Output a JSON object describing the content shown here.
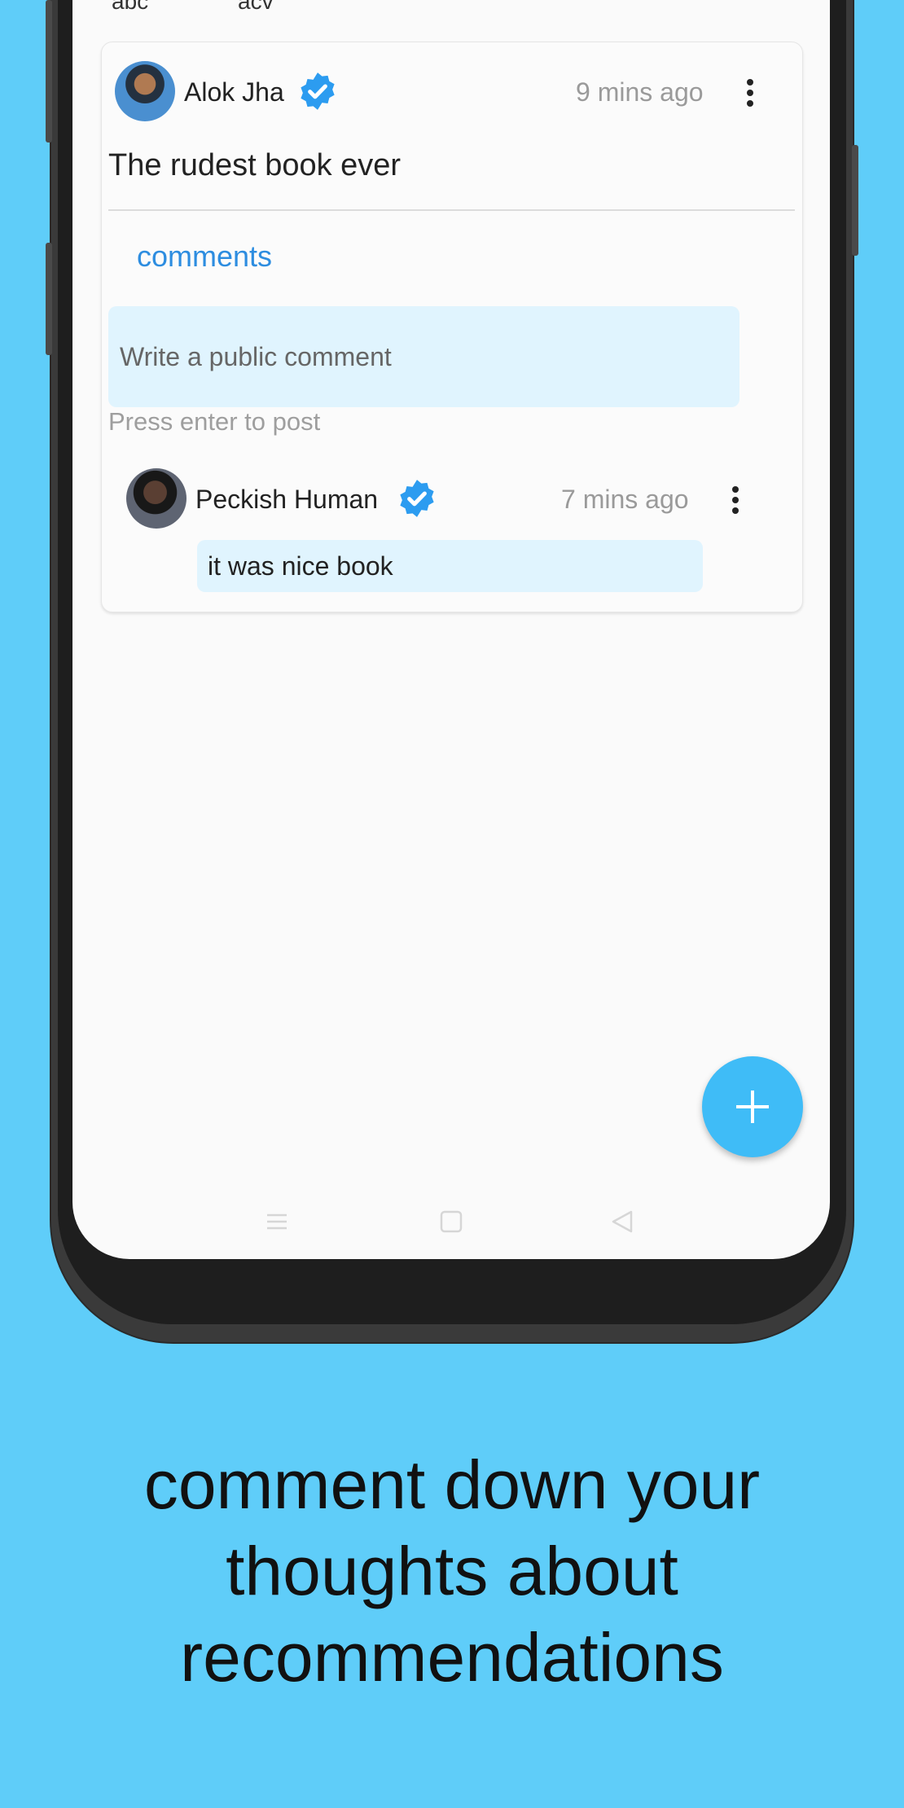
{
  "top_labels": [
    "abc",
    "acv"
  ],
  "post": {
    "author": "Alok Jha",
    "time": "9 mins ago",
    "text": "The rudest book ever"
  },
  "comments_section": {
    "label": "comments",
    "input_placeholder": "Write a public comment",
    "hint": "Press enter to post"
  },
  "comment": {
    "author": "Peckish Human",
    "time": "7 mins ago",
    "text": "it was nice book"
  },
  "caption": [
    "comment down your",
    "thoughts about",
    "recommendations"
  ],
  "colors": {
    "background": "#5fcdf9",
    "accent": "#2d8de0",
    "verified": "#2c9cf0",
    "fab": "#3fbcf7",
    "input_fill": "#e0f4fe"
  },
  "icons": [
    "verified-badge-icon",
    "more-vert-icon",
    "add-icon",
    "nav-menu-icon",
    "nav-home-icon",
    "nav-back-icon"
  ]
}
